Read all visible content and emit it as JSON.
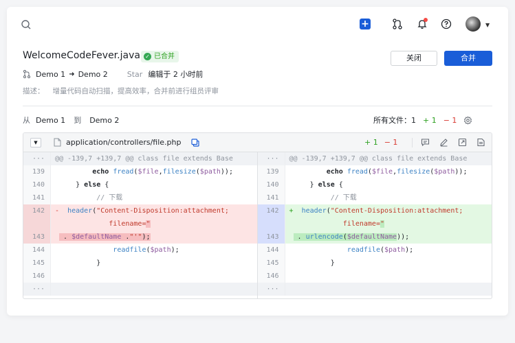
{
  "colors": {
    "accent": "#1a5dd8",
    "success": "#2ea121",
    "danger": "#d83931"
  },
  "topbar": {
    "icons": [
      "search-icon",
      "plus-icon",
      "pull-request-icon",
      "bell-icon",
      "help-icon",
      "avatar",
      "chevron-down-icon"
    ]
  },
  "header": {
    "title": "WelcomeCodeFever.java",
    "badge": "已合并",
    "close_label": "关闭",
    "merge_label": "合并",
    "source_branch": "Demo 1",
    "target_branch": "Demo 2",
    "star_label": "Star",
    "edited_text": "编辑于 2 小时前",
    "desc_label": "描述：",
    "desc_text": "增量代码自动扫描，提高效率，合并前进行组员评审"
  },
  "compare": {
    "from_label": "从",
    "from_branch": "Demo 1",
    "to_label": "到",
    "to_branch": "Demo 2",
    "all_files": "所有文件：1",
    "added": "+ 1",
    "removed": "− 1"
  },
  "file": {
    "path": "application/controllers/file.php",
    "added": "+ 1",
    "removed": "− 1",
    "hunk": "@@ -139,7 +139,7 @@ class file extends Base",
    "expand": "···",
    "left": [
      {
        "n": "139"
      },
      {
        "n": "140"
      },
      {
        "n": "141"
      },
      {
        "n": "142"
      },
      {
        "n": ""
      },
      {
        "n": "143"
      },
      {
        "n": "144"
      },
      {
        "n": "145"
      },
      {
        "n": "146"
      }
    ],
    "right": [
      {
        "n": "139"
      },
      {
        "n": "140"
      },
      {
        "n": "141"
      },
      {
        "n": "142"
      },
      {
        "n": ""
      },
      {
        "n": "143"
      },
      {
        "n": "144"
      },
      {
        "n": "145"
      },
      {
        "n": "146"
      }
    ]
  }
}
